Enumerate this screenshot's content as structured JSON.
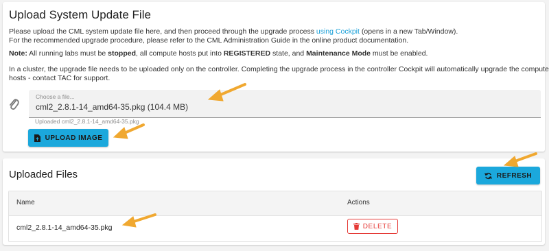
{
  "upload_card": {
    "title": "Upload System Update File",
    "intro_line1_before_link": "Please upload the CML system update file here, and then proceed through the upgrade process ",
    "intro_link": "using Cockpit",
    "intro_line1_after_link": " (opens in a new Tab/Window).",
    "intro_line2": "For the recommended upgrade procedure, please refer to the CML Administration Guide in the online product documentation.",
    "note_label": "Note:",
    "note_text1": " All running labs must be ",
    "note_bold1": "stopped",
    "note_text2": ", all compute hosts put into ",
    "note_bold2": "REGISTERED",
    "note_text3": " state, and ",
    "note_bold3": "Maintenance Mode",
    "note_text4": " must be enabled.",
    "cluster_line1": "In a cluster, the upgrade file needs to be uploaded only on the controller. Completing the upgrade process in the controller Cockpit will automatically upgrade the compute",
    "cluster_line2": "hosts - contact TAC for support.",
    "file_input": {
      "placeholder": "Choose a file...",
      "value": "cml2_2.8.1-14_amd64-35.pkg (104.4 MB)",
      "helper": "Uploaded cml2_2.8.1-14_amd64-35.pkg"
    },
    "upload_button": "UPLOAD IMAGE"
  },
  "files_card": {
    "title": "Uploaded Files",
    "refresh_button": "REFRESH",
    "columns": [
      "Name",
      "Actions"
    ],
    "rows": [
      {
        "name": "cml2_2.8.1-14_amd64-35.pkg",
        "action": "DELETE"
      }
    ]
  },
  "colors": {
    "accent": "#1ba8dc",
    "link": "#1ba0d8",
    "danger": "#e53935",
    "annotation_arrow": "#f0a830"
  },
  "icons": [
    "paperclip-icon",
    "file-upload-icon",
    "refresh-icon",
    "trash-icon",
    "annotation-arrow-icon"
  ]
}
